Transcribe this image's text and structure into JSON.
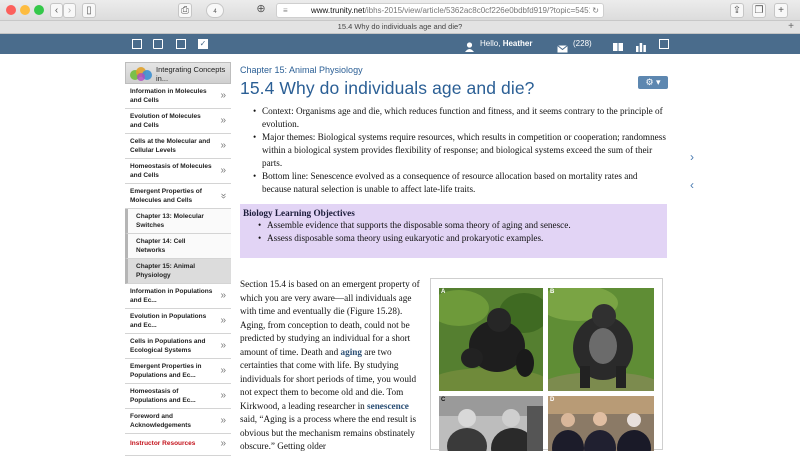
{
  "browser": {
    "url_domain": "www.trunity.net",
    "url_path": "/ibhs-2015/view/article/5362ac8c0cf226e0bdbfd919/?topic=5451",
    "tab_title": "15.4 Why do individuals age and die?",
    "badge_count": "4"
  },
  "site": {
    "greeting_prefix": "Hello,",
    "user_name": "Heather",
    "mail_count": "(228)"
  },
  "sidebar": {
    "header": "Integrating Concepts in...",
    "items": [
      {
        "label": "Information in Molecules and Cells",
        "chev": "»"
      },
      {
        "label": "Evolution of Molecules and Cells",
        "chev": "»"
      },
      {
        "label": "Cells at the Molecular and Cellular Levels",
        "chev": "»"
      },
      {
        "label": "Homeostasis of Molecules and Cells",
        "chev": "»"
      },
      {
        "label": "Emergent Properties of Molecules and Cells",
        "chev": "»"
      },
      {
        "label": "Chapter 13: Molecular Switches",
        "chev": ""
      },
      {
        "label": "Chapter 14: Cell Networks",
        "chev": ""
      },
      {
        "label": "Chapter 15: Animal Physiology",
        "chev": ""
      },
      {
        "label": "Information in Populations and Ec...",
        "chev": "»"
      },
      {
        "label": "Evolution in Populations and Ec...",
        "chev": "»"
      },
      {
        "label": "Cells in Populations and Ecological Systems",
        "chev": "»"
      },
      {
        "label": "Emergent Properties in Populations and Ec...",
        "chev": "»"
      },
      {
        "label": "Homeostasis of Populations and Ec...",
        "chev": "»"
      },
      {
        "label": "Foreword and Acknowledgements",
        "chev": "»"
      },
      {
        "label": "Instructor Resources",
        "chev": "»"
      }
    ]
  },
  "article": {
    "chapter": "Chapter 15: Animal Physiology",
    "title": "15.4 Why do individuals age and die?",
    "gear_label": "⚙ ▾",
    "bullets": [
      "Context: Organisms age and die, which reduces function and fitness, and it seems contrary to the principle of evolution.",
      "Major themes: Biological systems require resources, which results in competition or cooperation; randomness within a biological system provides flexibility of response; and biological systems exceed the sum of their parts.",
      "Bottom line: Senescence evolved as a consequence of resource allocation based on mortality rates and because natural selection is unable to affect late-life traits."
    ],
    "objectives_title": "Biology Learning Objectives",
    "objectives": [
      "Assemble evidence that supports the disposable soma theory of aging and senesce.",
      "Assess disposable soma theory using eukaryotic and prokaryotic examples."
    ],
    "body": {
      "part1": "Section 15.4 is based on an emergent property of which you are very aware—all individuals age with time and eventually die (Figure 15.28). Aging, from conception to death, could not be predicted by studying an individual for a short amount of time. Death and ",
      "kw1": "aging",
      "part2": " are two certainties that come with life. By studying individuals for short periods of time, you would not expect them to become old and die. Tom Kirkwood, a leading researcher in ",
      "kw2": "senescence",
      "part3": " said, “Aging is a process where the end result is obvious but the mechanism remains obstinately obscure.” Getting older"
    },
    "figure_labels": [
      "A",
      "B",
      "C",
      "D"
    ]
  },
  "colors": {
    "sitebar": "#4a6c8c",
    "link": "#2b5f95",
    "objectives_bg": "#e2d4f5",
    "instructor_red": "#c3121b"
  }
}
